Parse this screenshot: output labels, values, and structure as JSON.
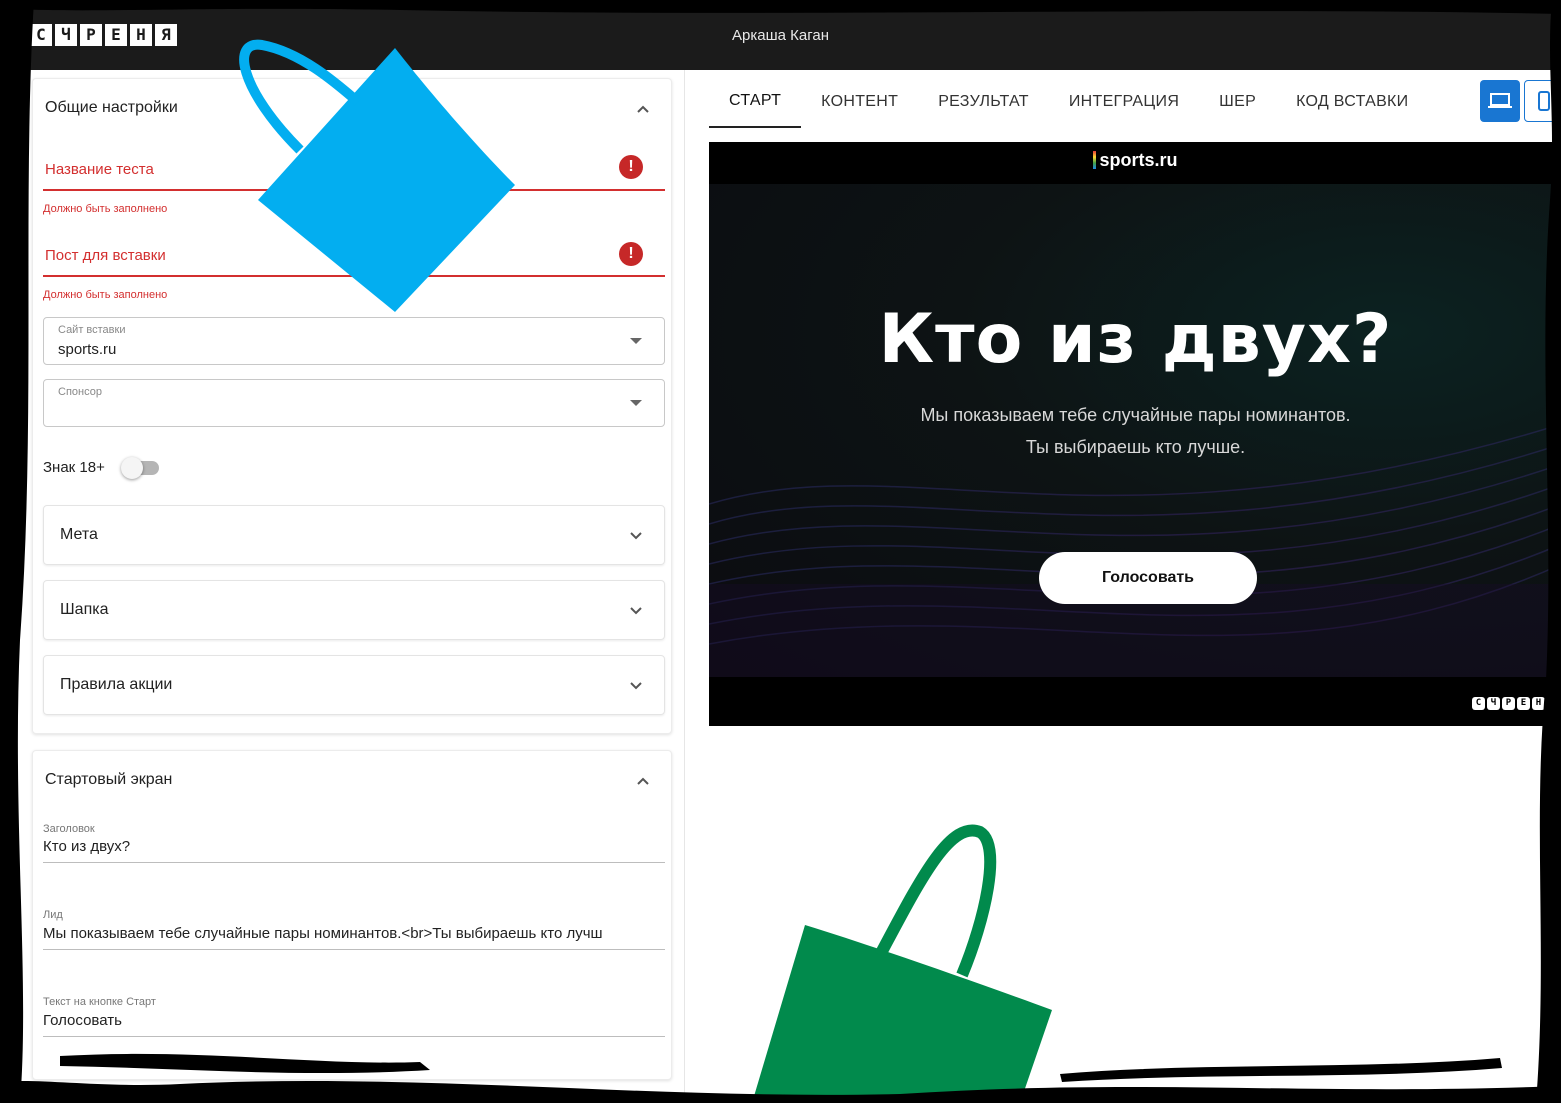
{
  "header": {
    "logo_letters": [
      "С",
      "Ч",
      "Р",
      "Е",
      "Н",
      "Я"
    ],
    "username": "Аркаша Каган"
  },
  "general_settings": {
    "title": "Общие настройки",
    "test_name": {
      "label": "Название теста",
      "error": "Должно быть заполнено"
    },
    "embed_post": {
      "label": "Пост для вставки",
      "error": "Должно быть заполнено"
    },
    "site": {
      "label": "Сайт вставки",
      "value": "sports.ru"
    },
    "sponsor": {
      "label": "Спонсор",
      "value": ""
    },
    "age_badge": {
      "label": "Знак 18+",
      "enabled": false
    },
    "accordions": [
      "Мета",
      "Шапка",
      "Правила акции"
    ]
  },
  "start_screen": {
    "title": "Стартовый экран",
    "heading": {
      "label": "Заголовок",
      "value": "Кто из двух?"
    },
    "lead": {
      "label": "Лид",
      "value": "Мы показываем тебе случайные пары номинантов.<br>Ты выбираешь кто лучш"
    },
    "button_text": {
      "label": "Текст на кнопке Старт",
      "value": "Голосовать"
    }
  },
  "tabs": [
    "СТАРТ",
    "КОНТЕНТ",
    "РЕЗУЛЬТАТ",
    "ИНТЕГРАЦИЯ",
    "ШЕР",
    "КОД ВСТАВКИ"
  ],
  "active_tab": "СТАРТ",
  "devices": {
    "desktop": "desktop-icon",
    "mobile": "mobile-icon",
    "selected": "desktop"
  },
  "preview": {
    "brand": "sports.ru",
    "title": "Кто из двух?",
    "subtitle_line1": "Мы показываем тебе случайные пары номинантов.",
    "subtitle_line2": "Ты выбираешь кто лучше.",
    "button": "Голосовать",
    "footer_logo": [
      "С",
      "Ч",
      "Р",
      "Е",
      "Н",
      "Я"
    ]
  },
  "colors": {
    "accent_blue": "#1976d2",
    "error_red": "#d32f2f",
    "header_bg": "#1b1b1b",
    "bag_blue": "#03aef0",
    "bag_green": "#018a4c"
  }
}
